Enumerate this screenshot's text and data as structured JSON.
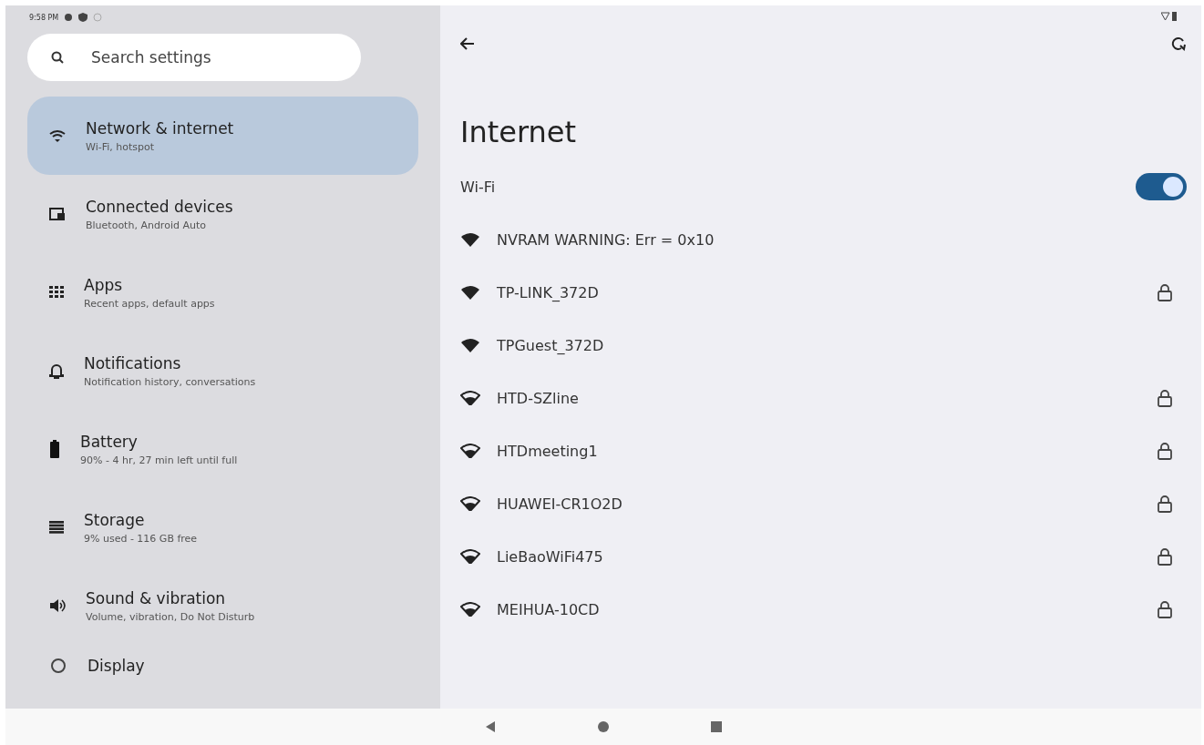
{
  "status_bar": {
    "time": "9:58 PM"
  },
  "search": {
    "placeholder": "Search settings"
  },
  "sidebar": {
    "items": [
      {
        "kind": "wifi",
        "title": "Network & internet",
        "subtitle": "Wi-Fi, hotspot",
        "selected": true
      },
      {
        "kind": "devices",
        "title": "Connected devices",
        "subtitle": "Bluetooth, Android Auto",
        "selected": false
      },
      {
        "kind": "apps",
        "title": "Apps",
        "subtitle": "Recent apps, default apps",
        "selected": false
      },
      {
        "kind": "bell",
        "title": "Notifications",
        "subtitle": "Notification history, conversations",
        "selected": false
      },
      {
        "kind": "battery",
        "title": "Battery",
        "subtitle": "90% - 4 hr, 27 min left until full",
        "selected": false
      },
      {
        "kind": "storage",
        "title": "Storage",
        "subtitle": "9% used - 116 GB free",
        "selected": false
      },
      {
        "kind": "sound",
        "title": "Sound & vibration",
        "subtitle": "Volume, vibration, Do Not Disturb",
        "selected": false
      },
      {
        "kind": "display",
        "title": "Display",
        "selected": false
      }
    ]
  },
  "page": {
    "title": "Internet",
    "wifi": {
      "label": "Wi-Fi",
      "on": true
    },
    "networks": [
      {
        "name": "NVRAM WARNING: Err = 0x10",
        "strong_signal": true,
        "locked": false
      },
      {
        "name": "TP-LINK_372D",
        "strong_signal": true,
        "locked": true
      },
      {
        "name": "TPGuest_372D",
        "strong_signal": true,
        "locked": false
      },
      {
        "name": "HTD-SZline",
        "strong_signal": false,
        "locked": true
      },
      {
        "name": "HTDmeeting1",
        "strong_signal": false,
        "locked": true
      },
      {
        "name": "HUAWEI-CR1O2D",
        "strong_signal": false,
        "locked": true
      },
      {
        "name": "LieBaoWiFi475",
        "strong_signal": false,
        "locked": true
      },
      {
        "name": "MEIHUA-10CD",
        "strong_signal": false,
        "locked": true
      }
    ]
  }
}
